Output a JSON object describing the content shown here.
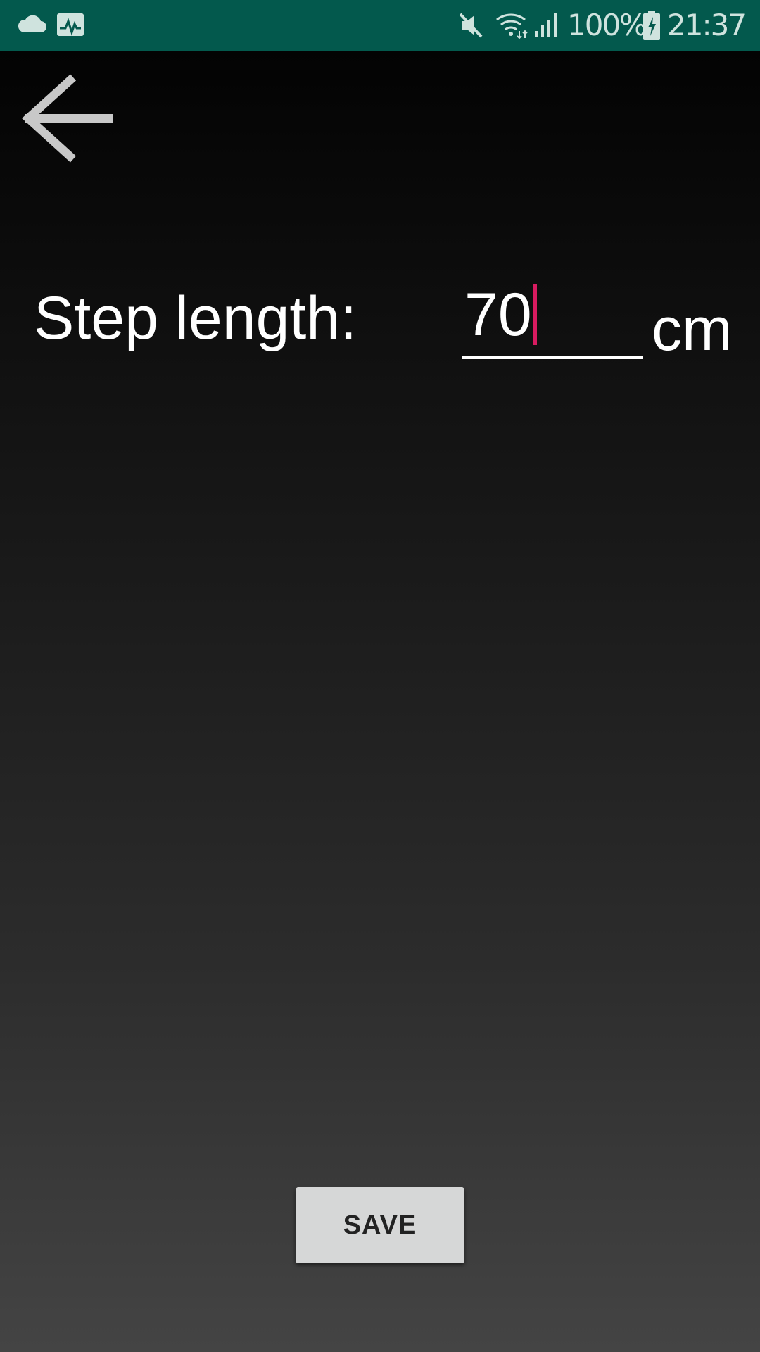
{
  "status_bar": {
    "icons": [
      "cloud-icon",
      "activity-pulse-icon",
      "mute-icon",
      "wifi-icon",
      "cell-signal-icon",
      "battery-charging-icon"
    ],
    "battery": "100%",
    "time": "21:37",
    "background_color": "#03594d"
  },
  "main": {
    "back_icon": "arrow-left-icon",
    "step_label": "Step length:",
    "step_value": "70",
    "unit": "cm",
    "save_label": "SAVE",
    "caret_color": "#d81b60"
  }
}
